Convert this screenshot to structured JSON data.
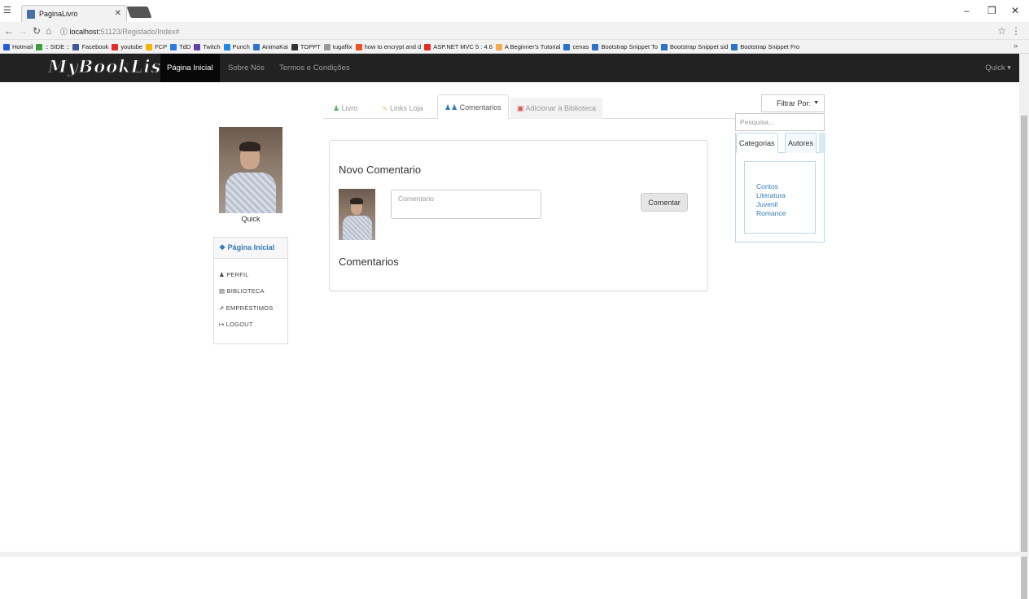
{
  "browser": {
    "tab_title": "PaginaLivro",
    "url_host": "localhost:",
    "url_rest": "51123/Registado/Index#",
    "bookmarks": [
      "Hotmail",
      ":: SIDE ::",
      "Facebook",
      "youtube",
      "FCP",
      "TdD",
      "Twitch",
      "Punch",
      "AnimaKai",
      "TOPPT",
      "tugaflix",
      "how to encrypt and d",
      "ASP.NET MVC 5 : 4.6",
      "A Beginner's Tutorial",
      "cenas",
      "Bootstrap Snippet To",
      "Bootstrap Snippet sid",
      "Bootstrap Snippet Fro"
    ]
  },
  "navbar": {
    "brand": "MyBookList",
    "links": [
      "Página Inicial",
      "Sobre Nós",
      "Termos e Condições"
    ],
    "user_menu": "Quick"
  },
  "profile": {
    "name": "Quick",
    "menu_title": "Página Inicial",
    "menu_items": [
      "PERFIL",
      "BIBLIOTECA",
      "EMPRÉSTIMOS",
      "LOGOUT"
    ]
  },
  "content_tabs": [
    "Livro",
    "Links Loja",
    "Comentarios",
    "Adicionar à Biblioteca"
  ],
  "comment_panel": {
    "title": "Novo Comentario",
    "placeholder": "Comentario",
    "button": "Comentar",
    "comments_title": "Comentarios"
  },
  "filter": {
    "select_label": "Filtrar Por:",
    "search_placeholder": "Pesquisa...",
    "tabs": [
      "Categorias",
      "Autores"
    ],
    "categories": [
      "Contos",
      "Literatura",
      "Juvenil",
      "Romance"
    ]
  },
  "colors": {
    "navbar": "#222222",
    "link": "#337ab7",
    "filter_border": "#bcd8ee"
  }
}
